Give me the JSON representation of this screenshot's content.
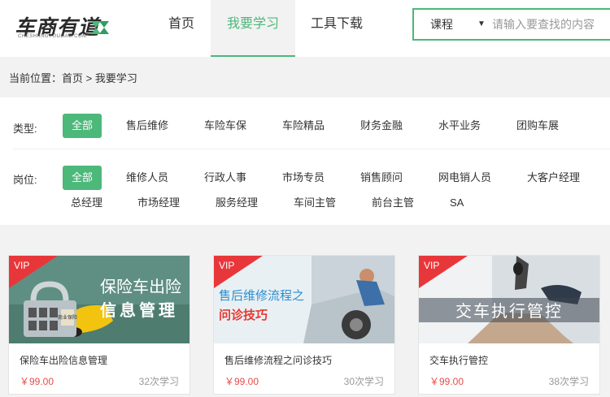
{
  "header": {
    "logo_text": "车商有道",
    "logo_sub": "CHESHANGYOUDAO.COM",
    "nav": [
      {
        "label": "首页"
      },
      {
        "label": "我要学习"
      },
      {
        "label": "工具下载"
      }
    ],
    "search": {
      "category": "课程",
      "placeholder": "请输入要查找的内容"
    }
  },
  "breadcrumb": "当前位置：首页 > 我要学习",
  "filters": {
    "type_label": "类型:",
    "type_options": [
      "全部",
      "售后维修",
      "车险车保",
      "车险精品",
      "财务金融",
      "水平业务",
      "团购车展"
    ],
    "type_selected": "全部",
    "post_label": "岗位:",
    "post_options": [
      "全部",
      "维修人员",
      "行政人事",
      "市场专员",
      "销售顾问",
      "网电销人员",
      "大客户经理",
      "总经理",
      "市场经理",
      "服务经理",
      "车间主管",
      "前台主管",
      "SA"
    ],
    "post_selected": "全部"
  },
  "courses": [
    {
      "badge": "VIP",
      "image_text_1": "保险车出险",
      "image_text_2": "信息管理",
      "lock_label": "商业保险",
      "title": "保险车出险信息管理",
      "price": "￥99.00",
      "count": "32次学习"
    },
    {
      "badge": "VIP",
      "image_text_1": "售后维修流程之",
      "image_text_2": "问诊技巧",
      "title": "售后维修流程之问诊技巧",
      "price": "￥99.00",
      "count": "30次学习"
    },
    {
      "badge": "VIP",
      "image_text_1": "交车执行管控",
      "title": "交车执行管控",
      "price": "￥99.00",
      "count": "38次学习"
    }
  ],
  "colors": {
    "accent": "#4cb87a",
    "vip": "#e8373a",
    "price": "#e94a4a"
  }
}
